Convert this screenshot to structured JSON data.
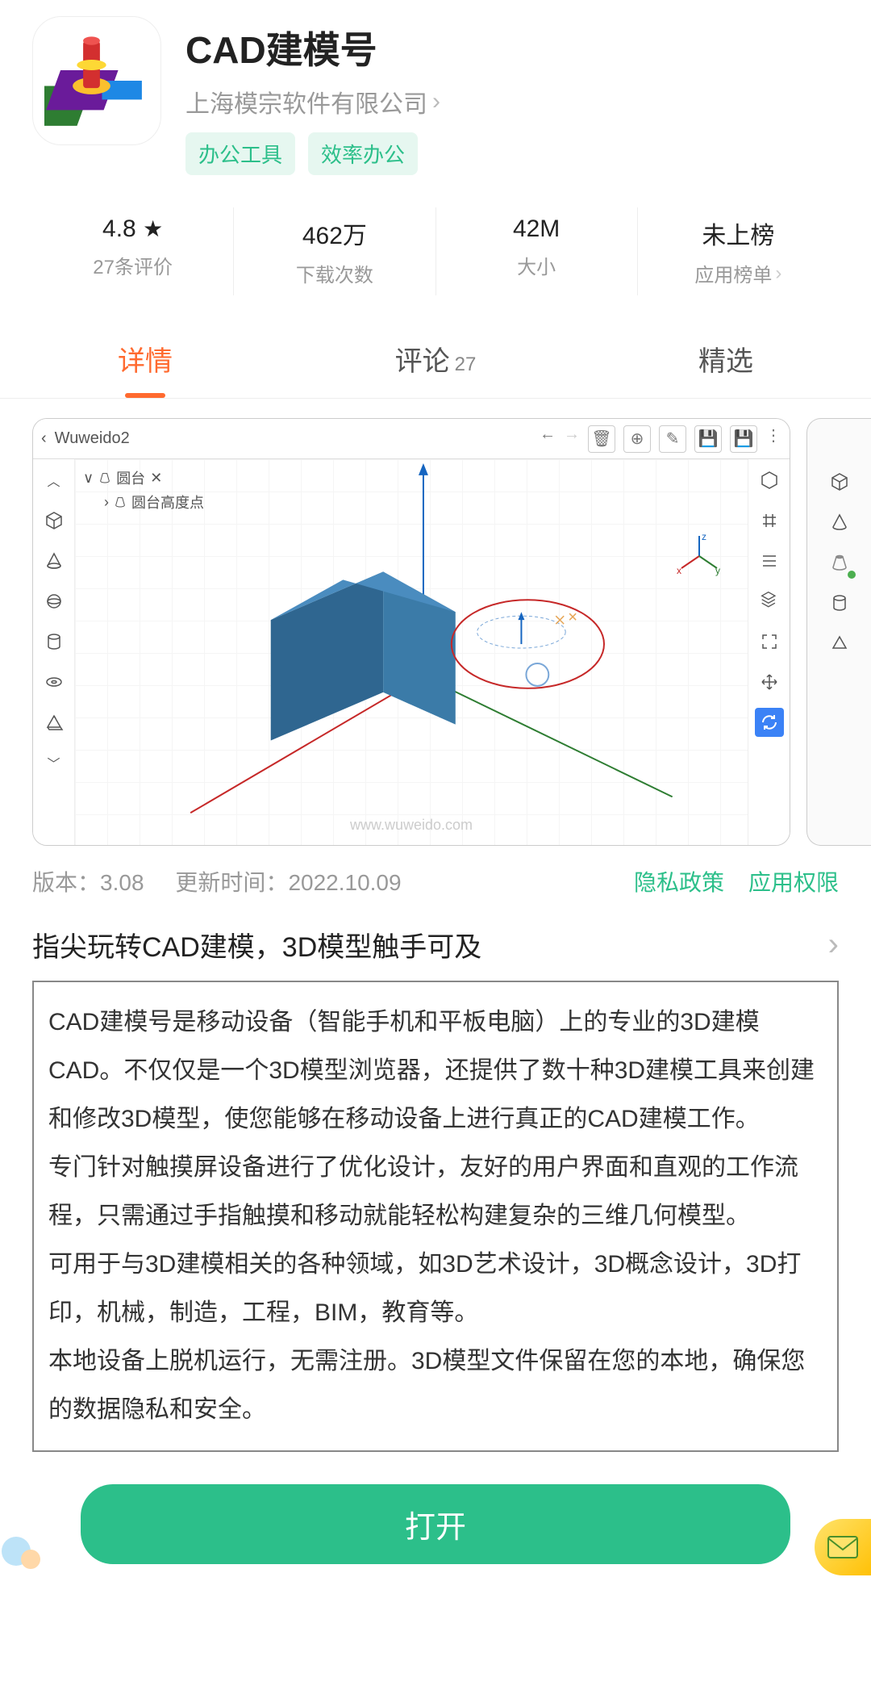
{
  "app": {
    "title": "CAD建模号",
    "developer": "上海模宗软件有限公司",
    "tags": [
      "办公工具",
      "效率办公"
    ]
  },
  "stats": {
    "rating": "4.8",
    "rating_sub": "27条评价",
    "downloads": "462万",
    "downloads_sub": "下载次数",
    "size": "42M",
    "size_sub": "大小",
    "rank": "未上榜",
    "rank_sub": "应用榜单"
  },
  "tabs": {
    "details": "详情",
    "reviews": "评论",
    "reviews_count": "27",
    "featured": "精选"
  },
  "screenshot": {
    "filename": "Wuweido2",
    "tree_item_1": "圆台",
    "tree_item_2": "圆台高度点",
    "watermark": "www.wuweido.com"
  },
  "meta": {
    "version_label": "版本：",
    "version": "3.08",
    "update_label": "更新时间：",
    "update_date": "2022.10.09",
    "privacy": "隐私政策",
    "permissions": "应用权限"
  },
  "slogan": "指尖玩转CAD建模，3D模型触手可及",
  "description": {
    "p1": "CAD建模号是移动设备（智能手机和平板电脑）上的专业的3D建模CAD。不仅仅是一个3D模型浏览器，还提供了数十种3D建模工具来创建和修改3D模型，使您能够在移动设备上进行真正的CAD建模工作。",
    "p2": "专门针对触摸屏设备进行了优化设计，友好的用户界面和直观的工作流程，只需通过手指触摸和移动就能轻松构建复杂的三维几何模型。",
    "p3": "可用于与3D建模相关的各种领域，如3D艺术设计，3D概念设计，3D打印，机械，制造，工程，BIM，教育等。",
    "p4": "本地设备上脱机运行，无需注册。3D模型文件保留在您的本地，确保您的数据隐私和安全。"
  },
  "open_button": "打开"
}
